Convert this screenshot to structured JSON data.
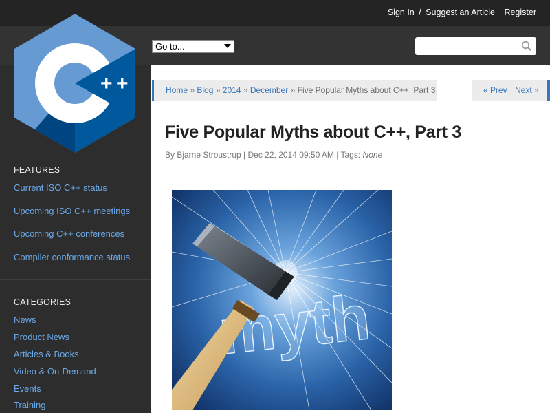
{
  "topbar": {
    "sign_in": "Sign In",
    "separator": "/",
    "suggest": "Suggest an Article",
    "register": "Register"
  },
  "header": {
    "goto_value": "Go to...",
    "search_placeholder": ""
  },
  "logo": {
    "icon": "cpp-logo",
    "text": "C++"
  },
  "sidebar": {
    "features_heading": "FEATURES",
    "features": [
      "Current ISO C++ status",
      "Upcoming ISO C++ meetings",
      "Upcoming C++ conferences",
      "Compiler conformance status"
    ],
    "categories_heading": "CATEGORIES",
    "categories": [
      "News",
      "Product News",
      "Articles & Books",
      "Video & On-Demand",
      "Events",
      "Training"
    ]
  },
  "breadcrumb": {
    "items": [
      "Home",
      "Blog",
      "2014",
      "December"
    ],
    "separator": "»",
    "current": "Five Popular Myths about C++, Part 3"
  },
  "pager": {
    "prev": "« Prev",
    "next": "Next »"
  },
  "article": {
    "title": "Five Popular Myths about C++, Part 3",
    "meta_prefix": "By Bjarne Stroustrup | Dec 22, 2014 09:50 AM | Tags:",
    "tags": "None",
    "image_word": "myth"
  },
  "colors": {
    "accent": "#3a76b8",
    "link": "#6aa9e8",
    "sidebar_bg": "#2d2d2d",
    "topbar_bg": "#242424"
  }
}
